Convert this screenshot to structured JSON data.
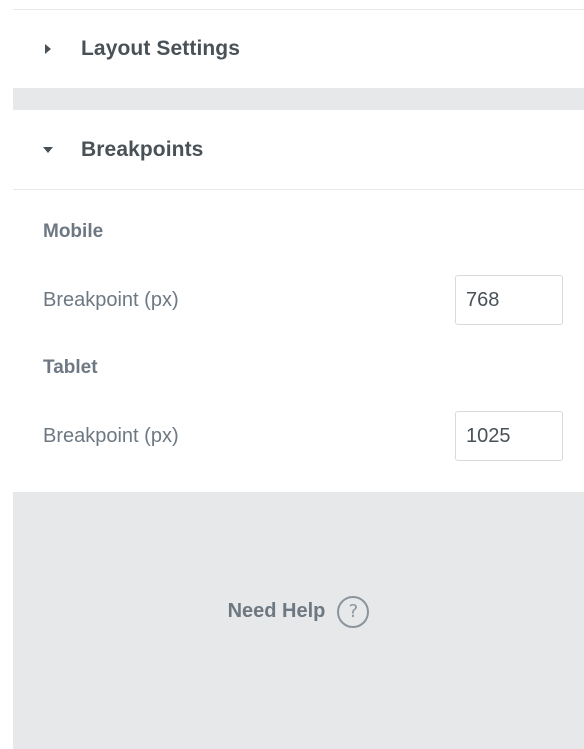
{
  "sections": {
    "layout_settings": {
      "title": "Layout Settings",
      "expanded": false
    },
    "breakpoints": {
      "title": "Breakpoints",
      "expanded": true
    }
  },
  "breakpoints": {
    "mobile": {
      "label": "Mobile",
      "field_label": "Breakpoint (px)",
      "value": "768"
    },
    "tablet": {
      "label": "Tablet",
      "field_label": "Breakpoint (px)",
      "value": "1025"
    }
  },
  "help": {
    "label": "Need Help",
    "icon": "question-circle-icon"
  },
  "colors": {
    "text": "#495157",
    "muted": "#6d7882",
    "divider": "#e6e8ea",
    "border": "#d5dadf"
  }
}
